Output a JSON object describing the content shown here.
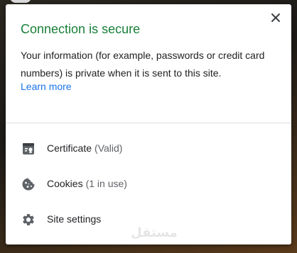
{
  "popup": {
    "title": "Connection is secure",
    "description": "Your information (for example, passwords or credit card numbers) is private when it is sent to this site.",
    "learn_more": "Learn more",
    "close_icon": "close-icon"
  },
  "items": [
    {
      "label": "Certificate",
      "sub": "(Valid)",
      "icon": "certificate-icon"
    },
    {
      "label": "Cookies",
      "sub": "(1 in use)",
      "icon": "cookie-icon"
    },
    {
      "label": "Site settings",
      "sub": "",
      "icon": "gear-icon"
    }
  ],
  "watermark": "مستقل",
  "colors": {
    "secure_green": "#188038",
    "link_blue": "#1a73e8",
    "text": "#202124",
    "secondary_text": "#5f6368",
    "icon_gray": "#5f6368"
  }
}
